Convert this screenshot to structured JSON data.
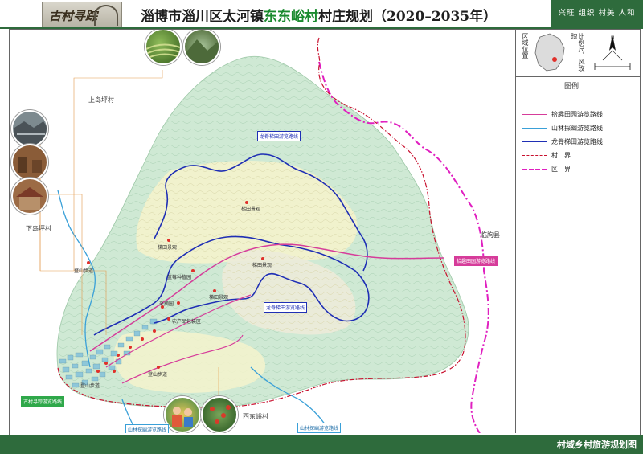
{
  "header": {
    "logo_text": "古村寻踪",
    "title_prefix": "淄博市淄川区太河镇",
    "title_highlight": "东东峪村",
    "title_suffix": "村庄规划（2020–2035年）",
    "slogan": "兴旺 组织 村美 人和"
  },
  "inset": {
    "location_label": "区域位置",
    "scale_label": "比例尺、风玫瑰",
    "compass_letter": "N"
  },
  "legend": {
    "title": "图例",
    "items": [
      {
        "label": "拾趣田园游览路线",
        "color": "#d63c9a",
        "style": "solid"
      },
      {
        "label": "山林探幽游览路线",
        "color": "#3aa0d8",
        "style": "solid"
      },
      {
        "label": "龙脊梯田游览路线",
        "color": "#1f2fb5",
        "style": "solid"
      },
      {
        "label": "村　界",
        "color": "#c8102e",
        "style": "dashdot"
      },
      {
        "label": "区　界",
        "color": "#e020c0",
        "style": "dashdot"
      }
    ]
  },
  "map_labels": {
    "shangdaopingcun": "上岛坪村",
    "xiadaopingcun": "下岛坪村",
    "linquxian": "临朐县",
    "xidongyucun": "西东峪村"
  },
  "route_tags": {
    "longji_top": "龙脊梯田游览路线",
    "longji_mid": "龙脊梯田游览路线",
    "shiqu": "拾趣田园游览路线",
    "guchun": "古村寻踪游览路线",
    "shanlin_1": "山林探幽游览路线",
    "shanlin_2": "山林探幽游览路线"
  },
  "pois": {
    "titian_1": "梯田景观",
    "titian_2": "梯田景观",
    "titian_3": "梯田景观",
    "titian_4": "梯田景观",
    "nongchanpin": "农产品包装区",
    "dengshan_1": "登山步道",
    "dengshan_2": "登山步道",
    "dengshan_3": "登山步道",
    "laocunluo": "采摘园",
    "shanshui": "蓝莓种植园"
  },
  "footer": {
    "text": "村域乡村旅游规划图"
  },
  "colors": {
    "brand_green": "#2e6b3c",
    "terrain_green": "#cfe9d4",
    "terrain_yellow": "#f4f3cc"
  }
}
